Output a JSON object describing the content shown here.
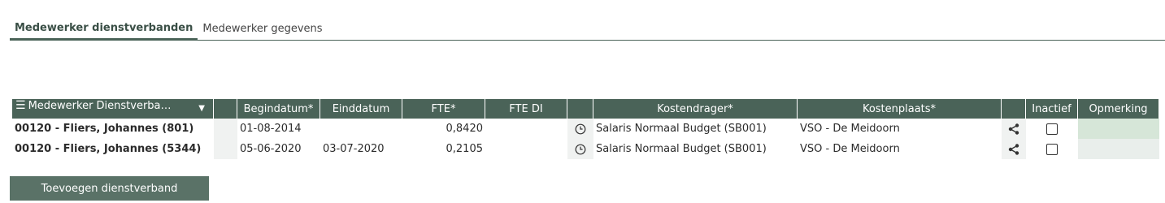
{
  "tabs": [
    {
      "label": "Medewerker dienstverbanden",
      "active": true
    },
    {
      "label": "Medewerker gegevens",
      "active": false
    }
  ],
  "table": {
    "columns": {
      "medewerker": "Medewerker Dienstverba…",
      "begindatum": "Begindatum*",
      "einddatum": "Einddatum",
      "fte": "FTE*",
      "fte_di": "FTE DI",
      "kostendrager": "Kostendrager*",
      "kostenplaats": "Kostenplaats*",
      "inactief": "Inactief",
      "opmerking": "Opmerking"
    },
    "rows": [
      {
        "medewerker": "00120 - Fliers, Johannes (801)",
        "begindatum": "01-08-2014",
        "einddatum": "",
        "fte": "0,8420",
        "fte_di": "",
        "kostendrager": "Salaris Normaal Budget (SB001)",
        "kostenplaats": "VSO - De Meidoorn",
        "inactief": false,
        "opmerking": ""
      },
      {
        "medewerker": "00120 - Fliers, Johannes (5344)",
        "begindatum": "05-06-2020",
        "einddatum": "03-07-2020",
        "fte": "0,2105",
        "fte_di": "",
        "kostendrager": "Salaris Normaal Budget (SB001)",
        "kostenplaats": "VSO - De Meidoorn",
        "inactief": false,
        "opmerking": ""
      }
    ]
  },
  "actions": {
    "add_label": "Toevoegen dienstverband"
  },
  "colors": {
    "header_bg": "#4a6358",
    "button_bg": "#5a7267",
    "opmerking_row1": "#d6e6d8",
    "opmerking_row2": "#e9eeeb"
  },
  "icons": {
    "menu": "menu-icon",
    "dropdown": "caret-down-icon",
    "clock": "clock-icon",
    "share": "share-icon"
  }
}
